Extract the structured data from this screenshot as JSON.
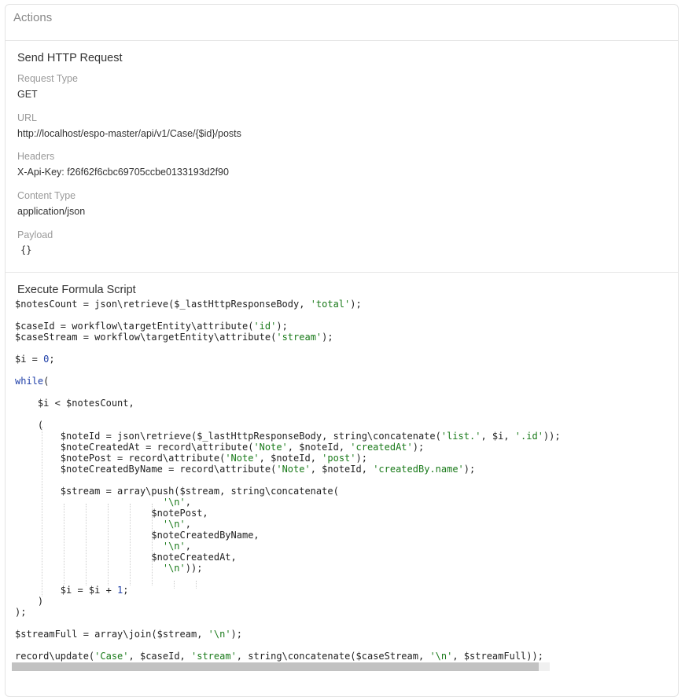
{
  "panel": {
    "title": "Actions"
  },
  "http_request": {
    "title": "Send HTTP Request",
    "request_type_label": "Request Type",
    "request_type_value": "GET",
    "url_label": "URL",
    "url_value": "http://localhost/espo-master/api/v1/Case/{$id}/posts",
    "headers_label": "Headers",
    "headers_value": "X-Api-Key: f26f62f6cbc69705ccbe0133193d2f90",
    "content_type_label": "Content Type",
    "content_type_value": "application/json",
    "payload_label": "Payload",
    "payload_value": "{}"
  },
  "formula": {
    "title": "Execute Formula Script",
    "lines": [
      [
        [
          "t",
          "$notesCount = json\\retrieve($_lastHttpResponseBody, "
        ],
        [
          "s",
          "'total'"
        ],
        [
          "t",
          ");"
        ]
      ],
      [],
      [
        [
          "t",
          "$caseId = workflow\\targetEntity\\attribute("
        ],
        [
          "s",
          "'id'"
        ],
        [
          "t",
          ");"
        ]
      ],
      [
        [
          "t",
          "$caseStream = workflow\\targetEntity\\attribute("
        ],
        [
          "s",
          "'stream'"
        ],
        [
          "t",
          ");"
        ]
      ],
      [],
      [
        [
          "t",
          "$i = "
        ],
        [
          "n",
          "0"
        ],
        [
          "t",
          ";"
        ]
      ],
      [],
      [
        [
          "k",
          "while"
        ],
        [
          "t",
          "("
        ]
      ],
      [],
      [
        [
          "t",
          "    $i < $notesCount,"
        ]
      ],
      [],
      [
        [
          "t",
          "    ("
        ]
      ],
      [
        [
          "t",
          "        $noteId = json\\retrieve($_lastHttpResponseBody, string\\concatenate("
        ],
        [
          "s",
          "'list.'"
        ],
        [
          "t",
          ", $i, "
        ],
        [
          "s",
          "'.id'"
        ],
        [
          "t",
          "));"
        ]
      ],
      [
        [
          "t",
          "        $noteCreatedAt = record\\attribute("
        ],
        [
          "s",
          "'Note'"
        ],
        [
          "t",
          ", $noteId, "
        ],
        [
          "s",
          "'createdAt'"
        ],
        [
          "t",
          ");"
        ]
      ],
      [
        [
          "t",
          "        $notePost = record\\attribute("
        ],
        [
          "s",
          "'Note'"
        ],
        [
          "t",
          ", $noteId, "
        ],
        [
          "s",
          "'post'"
        ],
        [
          "t",
          ");"
        ]
      ],
      [
        [
          "t",
          "        $noteCreatedByName = record\\attribute("
        ],
        [
          "s",
          "'Note'"
        ],
        [
          "t",
          ", $noteId, "
        ],
        [
          "s",
          "'createdBy.name'"
        ],
        [
          "t",
          ");"
        ]
      ],
      [],
      [
        [
          "t",
          "        $stream = array\\push($stream, string\\concatenate("
        ]
      ],
      [
        [
          "t",
          "                          "
        ],
        [
          "s",
          "'\\n'"
        ],
        [
          "t",
          ","
        ]
      ],
      [
        [
          "t",
          "                        $notePost,"
        ]
      ],
      [
        [
          "t",
          "                          "
        ],
        [
          "s",
          "'\\n'"
        ],
        [
          "t",
          ","
        ]
      ],
      [
        [
          "t",
          "                        $noteCreatedByName,"
        ]
      ],
      [
        [
          "t",
          "                          "
        ],
        [
          "s",
          "'\\n'"
        ],
        [
          "t",
          ","
        ]
      ],
      [
        [
          "t",
          "                        $noteCreatedAt,"
        ]
      ],
      [
        [
          "t",
          "                          "
        ],
        [
          "s",
          "'\\n'"
        ],
        [
          "t",
          "));"
        ]
      ],
      [],
      [
        [
          "t",
          "        $i = $i + "
        ],
        [
          "n",
          "1"
        ],
        [
          "t",
          ";"
        ]
      ],
      [
        [
          "t",
          "    )"
        ]
      ],
      [
        [
          "t",
          ");"
        ]
      ],
      [],
      [
        [
          "t",
          "$streamFull = array\\join($stream, "
        ],
        [
          "s",
          "'\\n'"
        ],
        [
          "t",
          ");"
        ]
      ],
      [],
      [
        [
          "t",
          "record\\update("
        ],
        [
          "s",
          "'Case'"
        ],
        [
          "t",
          ", $caseId, "
        ],
        [
          "s",
          "'stream'"
        ],
        [
          "t",
          ", string\\concatenate($caseStream, "
        ],
        [
          "s",
          "'\\n'"
        ],
        [
          "t",
          ", $streamFull));"
        ]
      ]
    ]
  },
  "scrollbar": {
    "visible_fraction": 0.98
  }
}
